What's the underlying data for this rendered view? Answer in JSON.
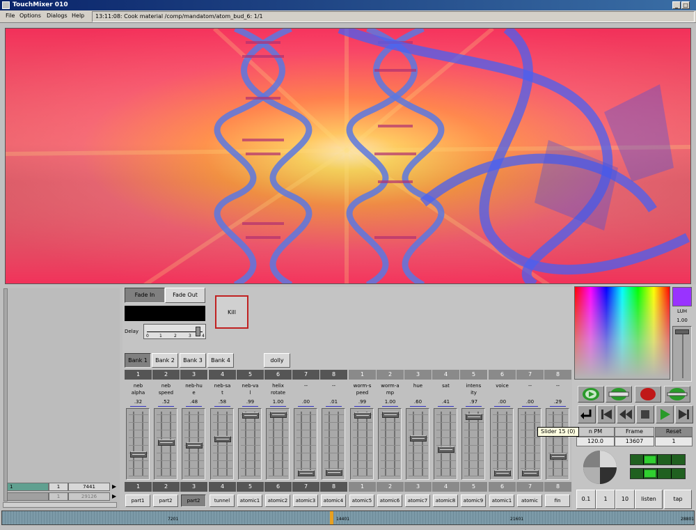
{
  "window": {
    "title": "TouchMixer 010"
  },
  "menu": [
    "File",
    "Options",
    "Dialogs",
    "Help"
  ],
  "status": "13:11:08:  Cook material /comp/mandatom/atom_bud_6: 1/1",
  "left_panel": {
    "row1": {
      "a": "1",
      "b": "1",
      "c": "7441"
    },
    "row2": {
      "b": "1",
      "c": "29126"
    }
  },
  "controls": {
    "fade_in": "Fade In",
    "fade_out": "Fade Out",
    "kill": "Kill",
    "delay_label": "Delay",
    "delay_ticks": [
      "0",
      "1",
      "2",
      "3",
      "4"
    ],
    "banks": [
      "Bank 1",
      "Bank 2",
      "Bank 3",
      "Bank 4"
    ],
    "dolly": "dolly"
  },
  "channels": [
    {
      "num": "1",
      "label": "neb\nalpha",
      "value": ".32",
      "level": 0.32,
      "button": "part1",
      "group": "a"
    },
    {
      "num": "2",
      "label": "neb\nspeed",
      "value": ".52",
      "level": 0.52,
      "button": "part2",
      "group": "a"
    },
    {
      "num": "3",
      "label": "neb-hu\ne",
      "value": ".48",
      "level": 0.48,
      "button": "part2",
      "group": "a",
      "active": true
    },
    {
      "num": "4",
      "label": "neb-sa\nt",
      "value": ".58",
      "level": 0.58,
      "button": "tunnel",
      "group": "a"
    },
    {
      "num": "5",
      "label": "neb-va\nl",
      "value": ".99",
      "level": 0.99,
      "button": "atomic1",
      "group": "a"
    },
    {
      "num": "6",
      "label": "helix\nrotate",
      "value": "1.00",
      "level": 1.0,
      "button": "atomic2",
      "group": "a"
    },
    {
      "num": "7",
      "label": "--",
      "value": ".00",
      "level": 0.0,
      "button": "atomic3",
      "group": "a"
    },
    {
      "num": "8",
      "label": "--",
      "value": ".01",
      "level": 0.01,
      "button": "atomic4",
      "group": "a"
    },
    {
      "num": "1",
      "label": "worm-s\npeed",
      "value": ".99",
      "level": 0.99,
      "button": "atomic5",
      "group": "b"
    },
    {
      "num": "2",
      "label": "worm-a\nmp",
      "value": "1.00",
      "level": 1.0,
      "button": "atomic6",
      "group": "b"
    },
    {
      "num": "3",
      "label": "hue",
      "value": ".60",
      "level": 0.6,
      "button": "atomic7",
      "group": "b"
    },
    {
      "num": "4",
      "label": "sat",
      "value": ".41",
      "level": 0.41,
      "button": "atomic8",
      "group": "b"
    },
    {
      "num": "5",
      "label": "intens\nity",
      "value": ".97",
      "level": 0.97,
      "button": "atomic9",
      "group": "b"
    },
    {
      "num": "6",
      "label": "voice",
      "value": ".00",
      "level": 0.0,
      "button": "atomic1",
      "group": "b"
    },
    {
      "num": "7",
      "label": "--",
      "value": ".00",
      "level": 0.0,
      "button": "atomic",
      "group": "b"
    },
    {
      "num": "8",
      "label": "--",
      "value": ".29",
      "level": 0.29,
      "button": "fin",
      "group": "b"
    }
  ],
  "right_panel": {
    "luh_label": "LUH",
    "luh_value": "1.00",
    "luh_level": 1.0,
    "swatch_color": "#9933ff",
    "tooltip": "Slider 15 (0)",
    "table_headers": [
      "n PM",
      "Frame",
      "Reset"
    ],
    "table_values": [
      "120.0",
      "13607",
      "1"
    ],
    "bottom_buttons": [
      "0.1",
      "1",
      "10",
      "listen",
      "tap"
    ]
  },
  "timeline": {
    "labels": [
      "7201",
      "14401",
      "21601",
      "28801"
    ],
    "playhead_frame": 13607,
    "max_frame": 28801
  },
  "colors": {
    "title_bar": "#0a246a",
    "channel_header_a": "#555555",
    "channel_header_b": "#8a8a8a",
    "kill_border": "#c02020"
  }
}
